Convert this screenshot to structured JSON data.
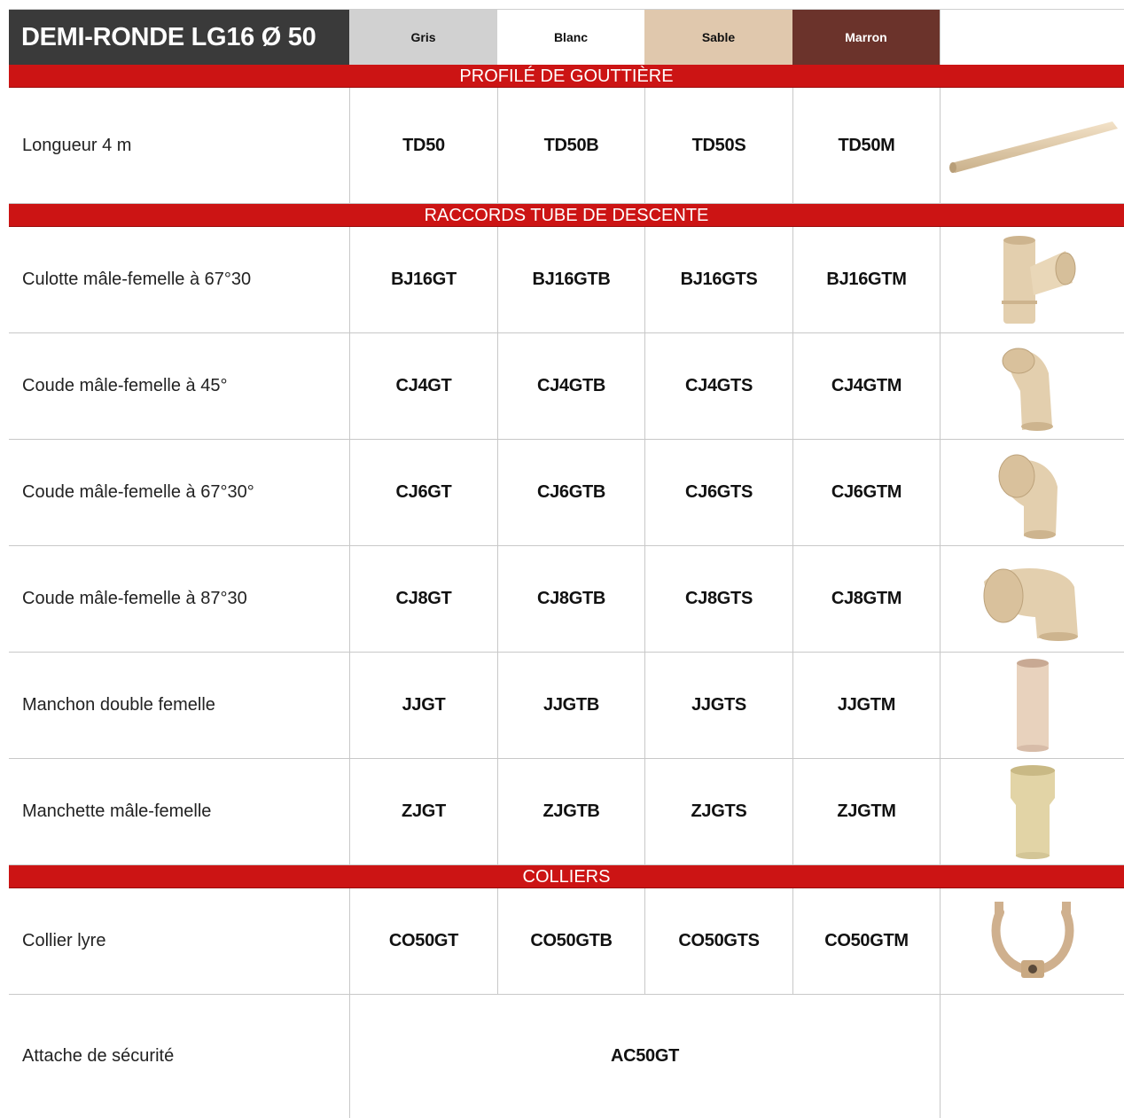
{
  "header": {
    "title": "DEMI-RONDE LG16 Ø 50",
    "colors": [
      {
        "label": "Gris",
        "hex": "#d1d1d1"
      },
      {
        "label": "Blanc",
        "hex": "#ffffff"
      },
      {
        "label": "Sable",
        "hex": "#e0c8ad"
      },
      {
        "label": "Marron",
        "hex": "#6b332b"
      }
    ]
  },
  "accent": "#cc1414",
  "sections": [
    {
      "title": "PROFILÉ DE GOUTTIÈRE",
      "rows": [
        {
          "label": "Longueur 4 m",
          "codes": [
            "TD50",
            "TD50B",
            "TD50S",
            "TD50M"
          ],
          "image": "gutter-profile-icon"
        }
      ]
    },
    {
      "title": "RACCORDS TUBE DE DESCENTE",
      "rows": [
        {
          "label": "Culotte mâle-femelle à 67°30",
          "codes": [
            "BJ16GT",
            "BJ16GTB",
            "BJ16GTS",
            "BJ16GTM"
          ],
          "image": "y-branch-icon"
        },
        {
          "label": "Coude mâle-femelle à 45°",
          "codes": [
            "CJ4GT",
            "CJ4GTB",
            "CJ4GTS",
            "CJ4GTM"
          ],
          "image": "elbow-45-icon"
        },
        {
          "label": "Coude mâle-femelle à 67°30°",
          "codes": [
            "CJ6GT",
            "CJ6GTB",
            "CJ6GTS",
            "CJ6GTM"
          ],
          "image": "elbow-67-icon"
        },
        {
          "label": "Coude mâle-femelle à 87°30",
          "codes": [
            "CJ8GT",
            "CJ8GTB",
            "CJ8GTS",
            "CJ8GTM"
          ],
          "image": "elbow-87-icon"
        },
        {
          "label": "Manchon double femelle",
          "codes": [
            "JJGT",
            "JJGTB",
            "JJGTS",
            "JJGTM"
          ],
          "image": "sleeve-icon"
        },
        {
          "label": "Manchette mâle-femelle",
          "codes": [
            "ZJGT",
            "ZJGTB",
            "ZJGTS",
            "ZJGTM"
          ],
          "image": "cuff-icon"
        }
      ]
    },
    {
      "title": "COLLIERS",
      "rows": [
        {
          "label": "Collier lyre",
          "codes": [
            "CO50GT",
            "CO50GTB",
            "CO50GTS",
            "CO50GTM"
          ],
          "image": "lyre-collar-icon"
        },
        {
          "label": "Attache de sécurité",
          "codes_all": "AC50GT"
        }
      ]
    }
  ]
}
